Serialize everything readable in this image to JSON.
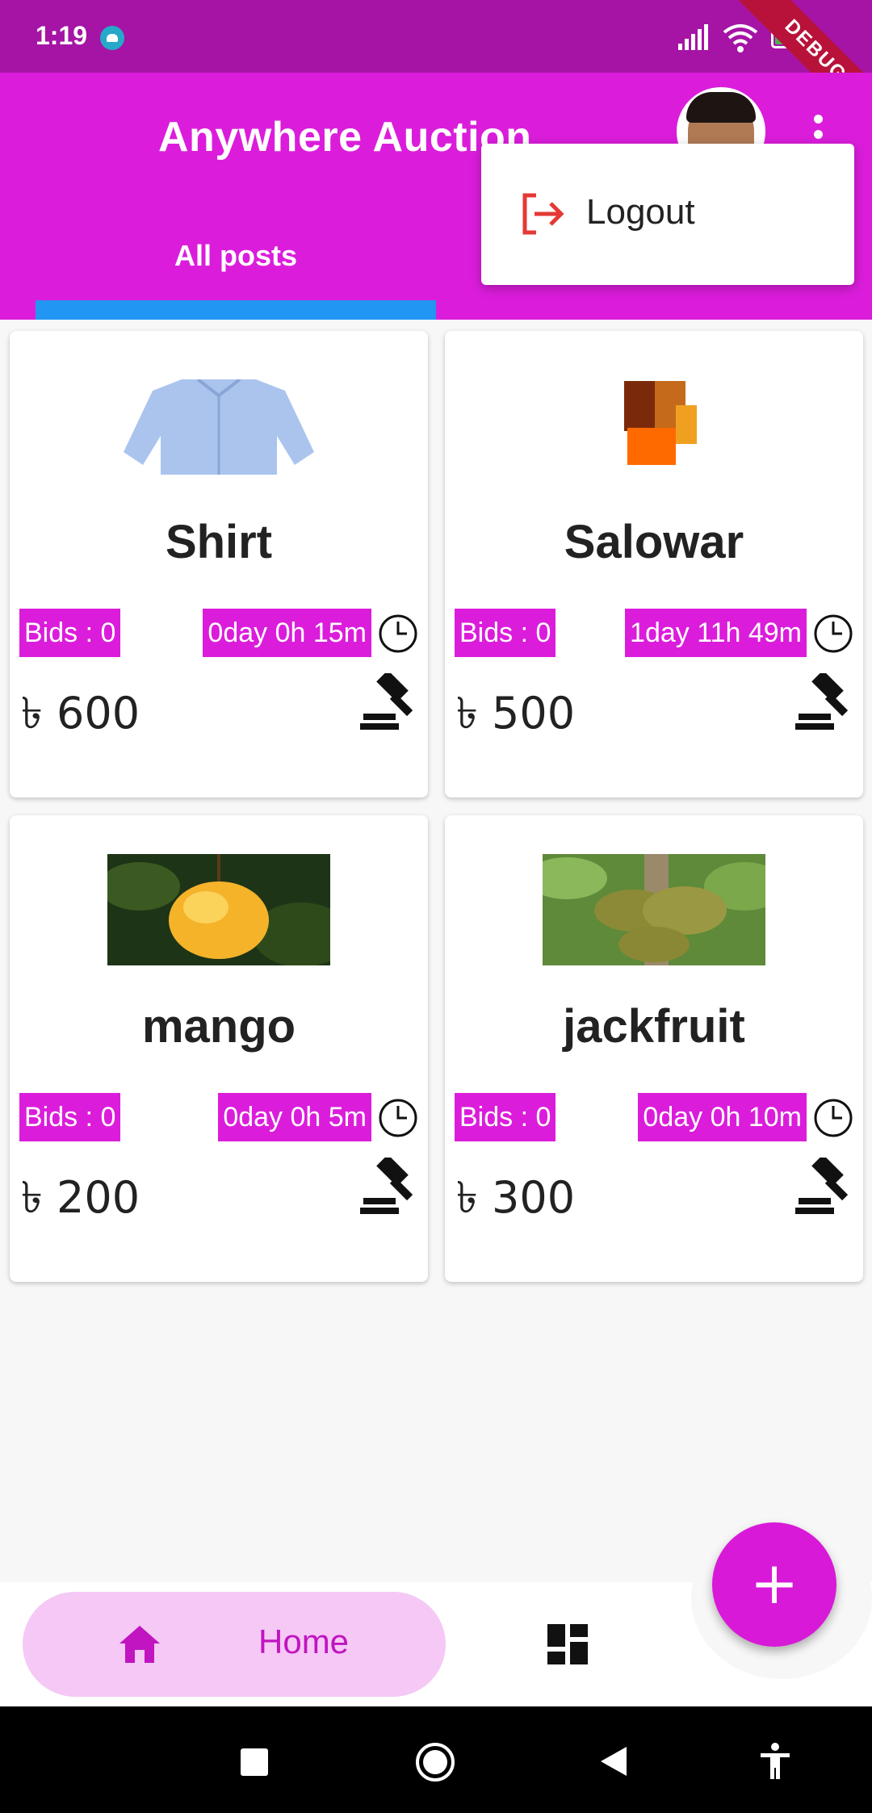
{
  "status_bar": {
    "time": "1:19",
    "battery": "29",
    "debug_label": "DEBUG"
  },
  "app_bar": {
    "title": "Anywhere Auction"
  },
  "tabs": [
    {
      "label": "All posts"
    }
  ],
  "popup_menu": {
    "items": [
      {
        "label": "Logout"
      }
    ]
  },
  "posts": [
    {
      "title": "Shirt",
      "bids": "Bids : 0",
      "time_left": "0day 0h 15m",
      "price": "৳ 600"
    },
    {
      "title": "Salowar",
      "bids": "Bids : 0",
      "time_left": "1day 11h 49m",
      "price": "৳ 500"
    },
    {
      "title": "mango",
      "bids": "Bids : 0",
      "time_left": "0day 0h 5m",
      "price": "৳ 200"
    },
    {
      "title": "jackfruit",
      "bids": "Bids : 0",
      "time_left": "0day 0h 10m",
      "price": "৳ 300"
    }
  ],
  "bottom_nav": {
    "home_label": "Home"
  },
  "fab": {
    "label": "+"
  },
  "icons": [
    "android-icon",
    "signal-icon",
    "wifi-icon",
    "battery-icon",
    "avatar",
    "more-vert-icon",
    "logout-icon",
    "clock-icon",
    "gavel-icon",
    "home-icon",
    "dashboard-icon",
    "plus-icon",
    "square-icon",
    "circle-icon",
    "back-icon",
    "accessibility-icon"
  ],
  "colors": {
    "primary": "#db1ddb",
    "status_bar": "#a514a5",
    "tab_indicator": "#2196f3",
    "logout": "#e53935",
    "home_pill": "#f5c8f5"
  }
}
